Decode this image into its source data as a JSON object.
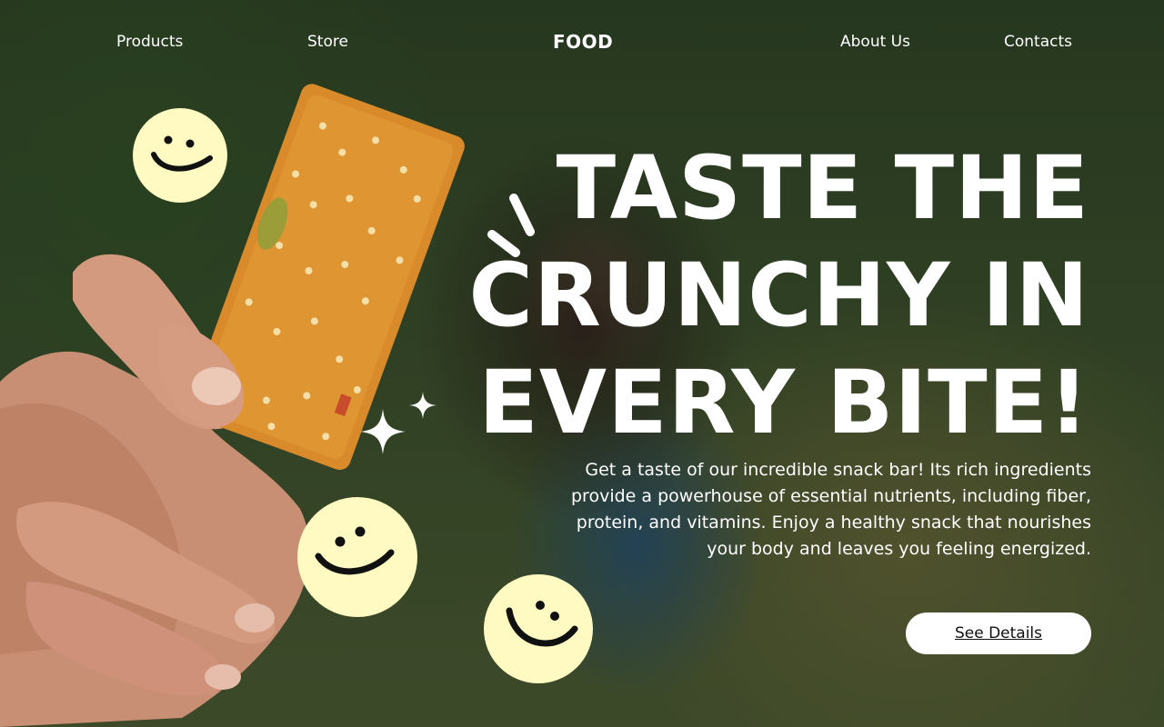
{
  "nav": {
    "left_links": [
      "Products",
      "Store"
    ],
    "logo": "FOOD",
    "right_links": [
      "About Us",
      "Contacts"
    ]
  },
  "hero": {
    "headline_lines": [
      "TASTE THE",
      "CRUNCHY IN",
      "EVERY BITE!"
    ],
    "description": "Get a taste of our incredible snack bar! Its rich ingredients provide a powerhouse of essential nutrients, including fiber, protein, and vitamins. Enjoy a healthy snack that nourishes your body and leaves you feeling energized.",
    "cta_label": "See Details"
  },
  "colors": {
    "smiley_fill": "#FFF9C2",
    "smiley_ink": "#111111",
    "button_bg": "#FFFFFF",
    "text": "#FFFFFF",
    "snack_bar": "#D98A2B"
  },
  "icons": [
    "smiley-icon",
    "sparkle-icon",
    "spark-lines-icon"
  ]
}
